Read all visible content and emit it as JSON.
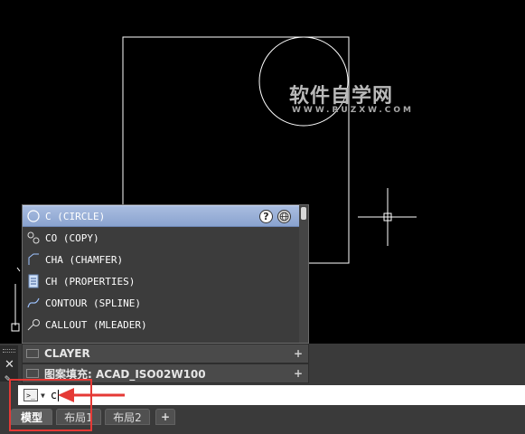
{
  "watermark": {
    "main": "软件自学网",
    "sub": "WWW.RUZXW.COM"
  },
  "suggestions": [
    {
      "label": "C (CIRCLE)",
      "icon": "circle-icon",
      "selected": true
    },
    {
      "label": "CO (COPY)",
      "icon": "copy-icon",
      "selected": false
    },
    {
      "label": "CHA (CHAMFER)",
      "icon": "chamfer-icon",
      "selected": false
    },
    {
      "label": "CH (PROPERTIES)",
      "icon": "properties-icon",
      "selected": false
    },
    {
      "label": "CONTOUR (SPLINE)",
      "icon": "spline-icon",
      "selected": false
    },
    {
      "label": "CALLOUT (MLEADER)",
      "icon": "mleader-icon",
      "selected": false
    }
  ],
  "suggest_buttons": {
    "help": "?",
    "web": "globe-icon"
  },
  "history": [
    {
      "label": "CLAYER",
      "plus": "+"
    },
    {
      "label": "图案填充: ACAD_ISO02W100",
      "plus": "+"
    }
  ],
  "command_line": {
    "prompt_icon": "command-prompt-icon",
    "value": "c"
  },
  "layout_tabs": [
    {
      "label": "模型",
      "active": true
    },
    {
      "label": "布局1",
      "active": false
    },
    {
      "label": "布局2",
      "active": false
    }
  ],
  "add_tab": "+",
  "colors": {
    "annotation": "#e53935",
    "selection": "#9bb1db",
    "background": "#000000"
  }
}
